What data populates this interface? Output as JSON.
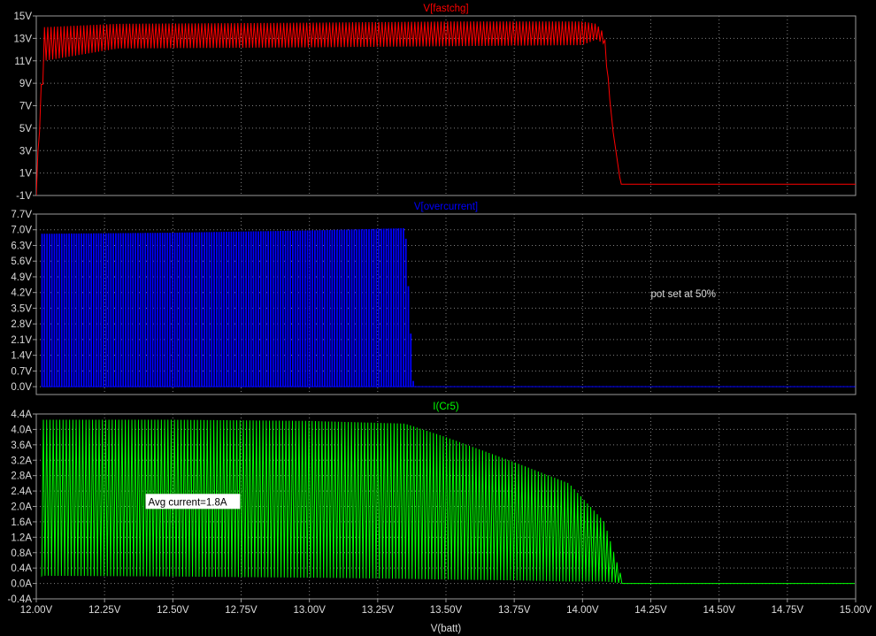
{
  "chart_data": {
    "type": "line",
    "x_axis": {
      "label": "V(batt)",
      "range": [
        12.0,
        15.0
      ],
      "ticks": [
        12.0,
        12.25,
        12.5,
        12.75,
        13.0,
        13.25,
        13.5,
        13.75,
        14.0,
        14.25,
        14.5,
        14.75,
        15.0
      ],
      "tick_labels": [
        "12.00V",
        "12.25V",
        "12.50V",
        "12.75V",
        "13.00V",
        "13.25V",
        "13.50V",
        "13.75V",
        "14.00V",
        "14.25V",
        "14.50V",
        "14.75V",
        "15.00V"
      ]
    },
    "panes": [
      {
        "title": "V[fastchg]",
        "color": "#ff0000",
        "ylim": [
          -1,
          15
        ],
        "y_ticks": [
          -1,
          1,
          3,
          5,
          7,
          9,
          11,
          13,
          15
        ],
        "y_tick_labels": [
          "-1V",
          "1V",
          "3V",
          "5V",
          "7V",
          "9V",
          "11V",
          "13V",
          "15V"
        ],
        "annotations": [],
        "series": {
          "style": "oscillating",
          "points": [
            {
              "x": 12.0,
              "low": -1.0,
              "high": -1.0
            },
            {
              "x": 12.01,
              "low": 4.0,
              "high": 5.5
            },
            {
              "x": 12.03,
              "low": 11.0,
              "high": 14.0
            },
            {
              "x": 12.3,
              "low": 12.1,
              "high": 14.3
            },
            {
              "x": 13.0,
              "low": 12.2,
              "high": 14.4
            },
            {
              "x": 13.5,
              "low": 12.3,
              "high": 14.5
            },
            {
              "x": 14.0,
              "low": 12.4,
              "high": 14.5
            },
            {
              "x": 14.05,
              "low": 12.9,
              "high": 14.3
            },
            {
              "x": 14.08,
              "low": 12.5,
              "high": 13.4
            },
            {
              "x": 14.11,
              "low": 5.0,
              "high": 5.0
            },
            {
              "x": 14.14,
              "low": 0.0,
              "high": 0.0
            },
            {
              "x": 15.0,
              "low": 0.0,
              "high": 0.0
            }
          ]
        }
      },
      {
        "title": "V[overcurrent]",
        "color": "#0000ff",
        "ylim": [
          -0.35,
          7.7
        ],
        "y_ticks": [
          0.0,
          0.7,
          1.4,
          2.1,
          2.8,
          3.5,
          4.2,
          4.9,
          5.6,
          6.3,
          7.0,
          7.7
        ],
        "y_tick_labels": [
          "0.0V",
          "0.7V",
          "1.4V",
          "2.1V",
          "2.8V",
          "3.5V",
          "4.2V",
          "4.9V",
          "5.6V",
          "6.3V",
          "7.0V",
          "7.7V"
        ],
        "annotations": [
          {
            "text": "pot set at 50%",
            "x": 14.25,
            "y": 4.0
          }
        ],
        "series": {
          "style": "pulse",
          "points": [
            {
              "x": 12.02,
              "low": 0.0,
              "high": 6.8
            },
            {
              "x": 12.5,
              "low": 0.0,
              "high": 6.85
            },
            {
              "x": 13.0,
              "low": 0.0,
              "high": 6.95
            },
            {
              "x": 13.35,
              "low": 0.0,
              "high": 7.05
            },
            {
              "x": 13.38,
              "low": 0.0,
              "high": 0.0
            },
            {
              "x": 15.0,
              "low": 0.0,
              "high": 0.0
            }
          ]
        }
      },
      {
        "title": "I(Cr5)",
        "color": "#00ff00",
        "ylim": [
          -0.4,
          4.4
        ],
        "y_ticks": [
          -0.4,
          0.0,
          0.4,
          0.8,
          1.2,
          1.6,
          2.0,
          2.4,
          2.8,
          3.2,
          3.6,
          4.0,
          4.4
        ],
        "y_tick_labels": [
          "-0.4A",
          "0.0A",
          "0.4A",
          "0.8A",
          "1.2A",
          "1.6A",
          "2.0A",
          "2.4A",
          "2.8A",
          "3.2A",
          "3.6A",
          "4.0A",
          "4.4A"
        ],
        "annotations": [
          {
            "text": "Avg current=1.8A",
            "x": 12.41,
            "y": 2.05,
            "boxed": true
          }
        ],
        "series": {
          "style": "oscillating",
          "points": [
            {
              "x": 12.02,
              "low": 0.2,
              "high": 4.25
            },
            {
              "x": 12.5,
              "low": 0.18,
              "high": 4.25
            },
            {
              "x": 13.0,
              "low": 0.15,
              "high": 4.22
            },
            {
              "x": 13.35,
              "low": 0.12,
              "high": 4.15
            },
            {
              "x": 13.5,
              "low": 0.1,
              "high": 3.8
            },
            {
              "x": 13.75,
              "low": 0.08,
              "high": 3.15
            },
            {
              "x": 13.95,
              "low": 0.05,
              "high": 2.6
            },
            {
              "x": 14.08,
              "low": 0.05,
              "high": 1.6
            },
            {
              "x": 14.15,
              "low": 0.0,
              "high": 0.0
            },
            {
              "x": 15.0,
              "low": 0.0,
              "high": 0.0
            }
          ]
        }
      }
    ]
  }
}
